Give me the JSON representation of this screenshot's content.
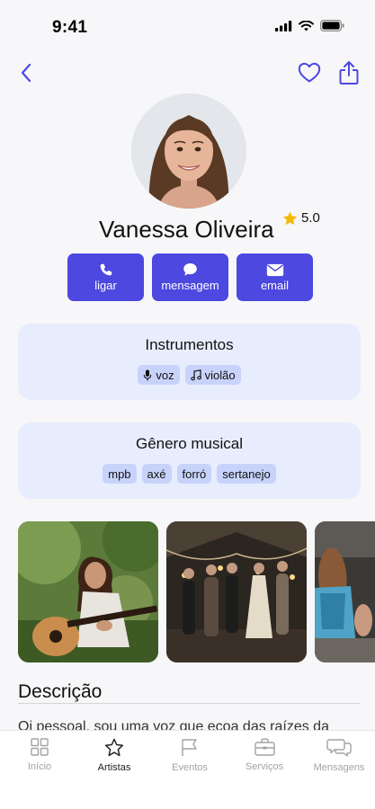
{
  "status_bar": {
    "time": "9:41"
  },
  "nav": {
    "back_icon": "chevron-left-icon",
    "favorite_icon": "heart-icon",
    "share_icon": "share-icon"
  },
  "colors": {
    "accent": "#4c48e0",
    "card_bg": "#e8edfd",
    "chip_bg": "#c8d3fb",
    "star": "#f5b800"
  },
  "profile": {
    "name": "Vanessa Oliveira",
    "rating": "5.0"
  },
  "actions": [
    {
      "label": "ligar",
      "icon": "phone-icon"
    },
    {
      "label": "mensagem",
      "icon": "chat-bubble-icon"
    },
    {
      "label": "email",
      "icon": "envelope-icon"
    }
  ],
  "instruments": {
    "title": "Instrumentos",
    "items": [
      {
        "label": "voz",
        "icon": "microphone-icon"
      },
      {
        "label": "violão",
        "icon": "music-note-icon"
      }
    ]
  },
  "genres": {
    "title": "Gênero musical",
    "items": [
      "mpb",
      "axé",
      "forró",
      "sertanejo"
    ]
  },
  "description": {
    "title": "Descrição",
    "text": "Oi pessoal, sou uma voz que ecoa das raízes da"
  },
  "tabbar": [
    {
      "label": "Início",
      "icon": "grid-icon",
      "active": false
    },
    {
      "label": "Artistas",
      "icon": "star-icon",
      "active": true
    },
    {
      "label": "Eventos",
      "icon": "flag-icon",
      "active": false
    },
    {
      "label": "Serviços",
      "icon": "briefcase-icon",
      "active": false
    },
    {
      "label": "Mensagens",
      "icon": "chat-icon",
      "active": false
    }
  ]
}
